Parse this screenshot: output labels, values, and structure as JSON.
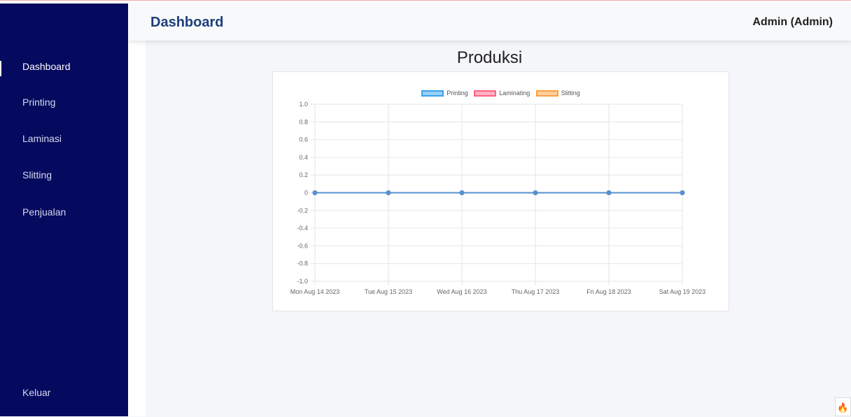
{
  "header": {
    "title": "Dashboard",
    "user": "Admin (Admin)"
  },
  "sidebar": {
    "items": [
      {
        "label": "Dashboard",
        "active": true
      },
      {
        "label": "Printing"
      },
      {
        "label": "Laminasi"
      },
      {
        "label": "Slitting"
      },
      {
        "label": "Penjualan"
      }
    ],
    "logout": "Keluar"
  },
  "main": {
    "chart_title": "Produksi"
  },
  "chart_data": {
    "type": "line",
    "title": "Produksi",
    "categories": [
      "Mon Aug 14 2023",
      "Tue Aug 15 2023",
      "Wed Aug 16 2023",
      "Thu Aug 17 2023",
      "Fri Aug 18 2023",
      "Sat Aug 19 2023"
    ],
    "series": [
      {
        "name": "Printing",
        "values": [
          0,
          0,
          0,
          0,
          0,
          0
        ],
        "color": "#36a2eb"
      },
      {
        "name": "Laminating",
        "values": [
          0,
          0,
          0,
          0,
          0,
          0
        ],
        "color": "#ff6384"
      },
      {
        "name": "Slitting",
        "values": [
          0,
          0,
          0,
          0,
          0,
          0
        ],
        "color": "#ff9f40"
      }
    ],
    "yticks": [
      "1.0",
      "0.8",
      "0.6",
      "0.4",
      "0.2",
      "0",
      "-0.2",
      "-0.4",
      "-0.6",
      "-0.8",
      "-1.0"
    ],
    "ylim": [
      -1,
      1
    ],
    "legend": "top",
    "grid": true
  },
  "icons": {
    "corner": "fire-icon"
  }
}
